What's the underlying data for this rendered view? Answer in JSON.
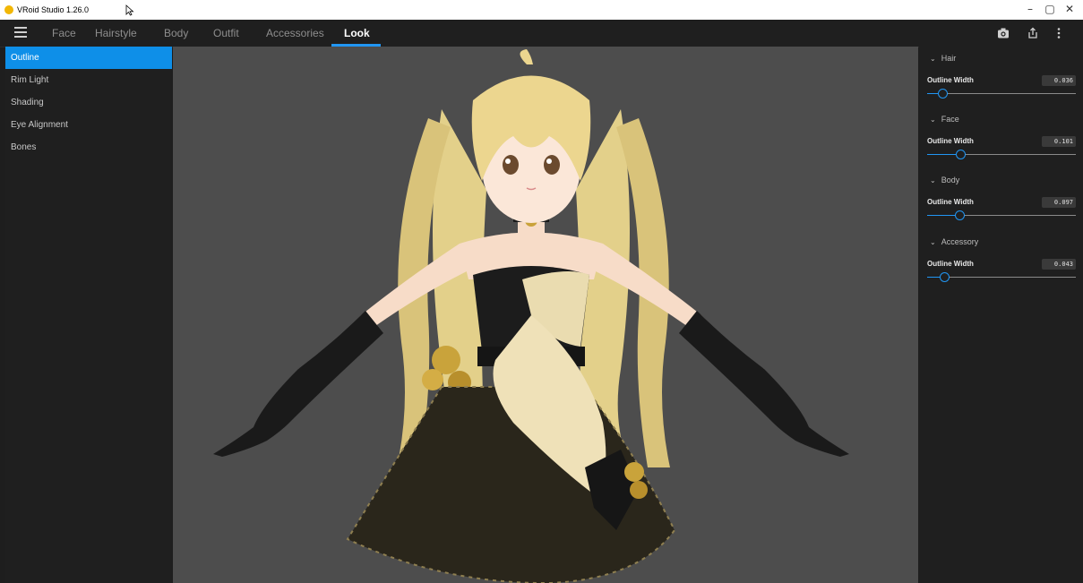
{
  "window": {
    "title": "VRoid Studio 1.26.0",
    "controls": {
      "minimize": "–",
      "restore": "▢",
      "close": "✕"
    }
  },
  "menubar": {
    "tabs": [
      {
        "label": "Face"
      },
      {
        "label": "Hairstyle"
      },
      {
        "label": "Body"
      },
      {
        "label": "Outfit"
      },
      {
        "label": "Accessories"
      },
      {
        "label": "Look",
        "active": true
      }
    ],
    "tools": [
      "camera-icon",
      "export-icon",
      "more-vertical-icon"
    ]
  },
  "sidebar": {
    "items": [
      {
        "label": "Outline",
        "active": true
      },
      {
        "label": "Rim Light"
      },
      {
        "label": "Shading"
      },
      {
        "label": "Eye Alignment"
      },
      {
        "label": "Bones"
      }
    ]
  },
  "panel": {
    "sections": [
      {
        "title": "Hair",
        "param": "Outline Width",
        "value": "0.036",
        "level": 0.036
      },
      {
        "title": "Face",
        "param": "Outline Width",
        "value": "0.101",
        "level": 0.101
      },
      {
        "title": "Body",
        "param": "Outline Width",
        "value": "0.097",
        "level": 0.097
      },
      {
        "title": "Accessory",
        "param": "Outline Width",
        "value": "0.043",
        "level": 0.043
      }
    ]
  },
  "colors": {
    "accent": "#2196f3",
    "active_item": "#0e8fe8",
    "viewport": "#4d4d4d"
  }
}
